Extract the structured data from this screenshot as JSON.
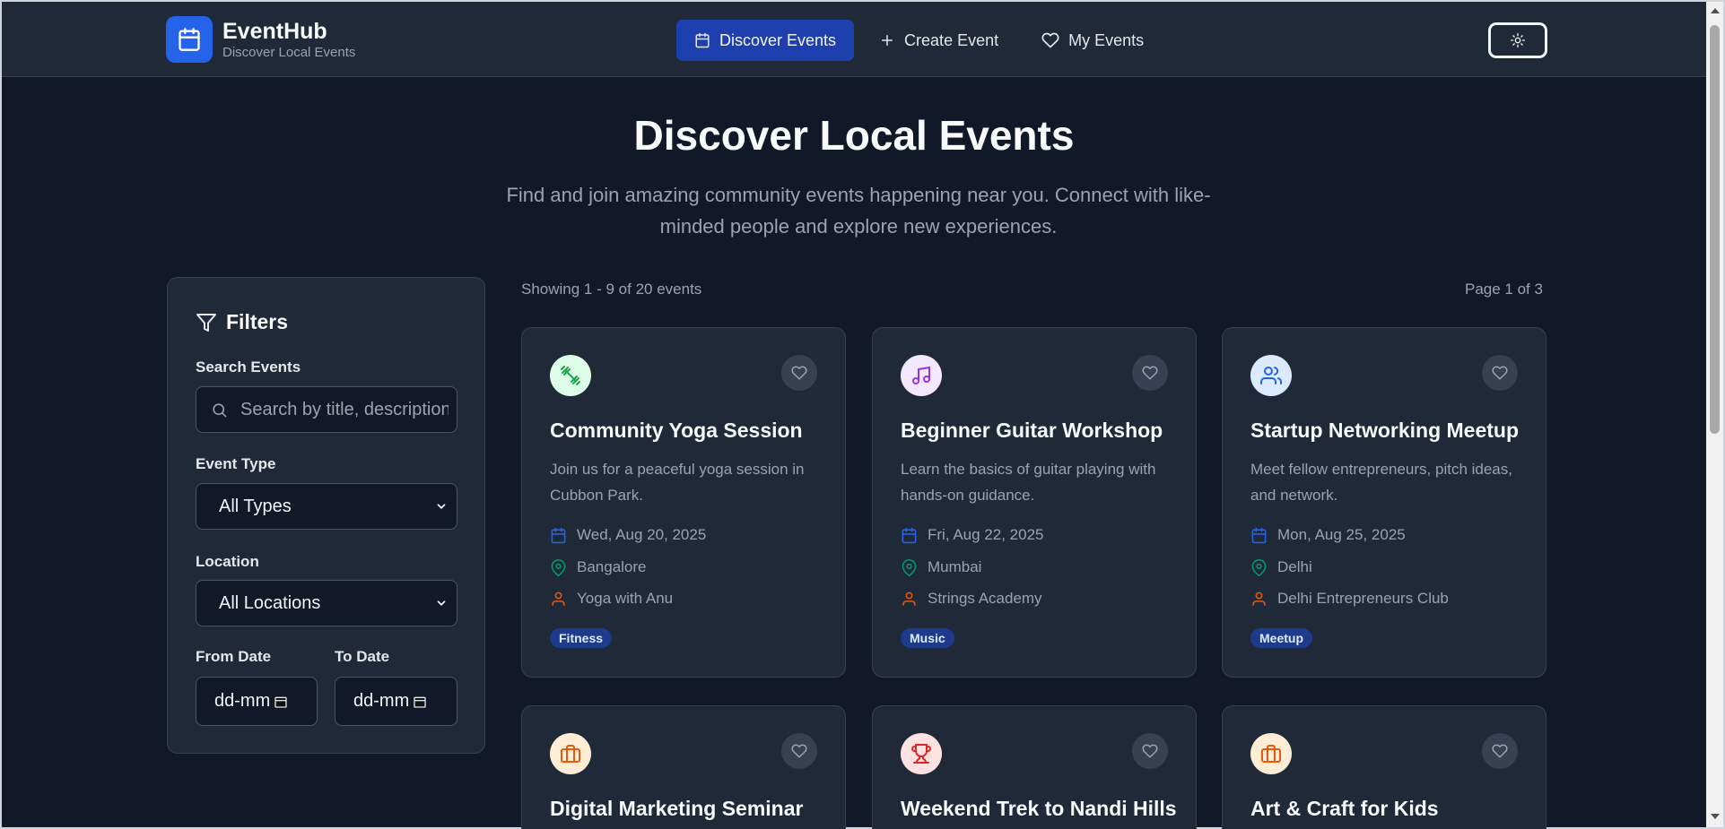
{
  "header": {
    "brand_name": "EventHub",
    "brand_sub": "Discover Local Events",
    "nav": [
      {
        "label": "Discover Events",
        "icon": "calendar-icon",
        "active": true
      },
      {
        "label": "Create Event",
        "icon": "plus-icon",
        "active": false
      },
      {
        "label": "My Events",
        "icon": "heart-icon",
        "active": false
      }
    ],
    "theme_toggle_icon": "sun-icon"
  },
  "hero": {
    "title": "Discover Local Events",
    "subtitle_line1": "Find and join amazing community events happening near you. Connect with like-",
    "subtitle_line2": "minded people and explore new experiences."
  },
  "filters": {
    "title": "Filters",
    "search_label": "Search Events",
    "search_placeholder": "Search by title, description...",
    "type_label": "Event Type",
    "type_value": "All Types",
    "location_label": "Location",
    "location_value": "All Locations",
    "from_label": "From Date",
    "to_label": "To Date",
    "from_value": "dd-mm",
    "to_value": "dd-mm"
  },
  "results": {
    "showing": "Showing 1 - 9 of 20 events",
    "page": "Page 1 of 3"
  },
  "cards": [
    {
      "title": "Community Yoga Session",
      "desc": "Join us for a peaceful yoga session in Cubbon Park.",
      "date": "Wed, Aug 20, 2025",
      "location": "Bangalore",
      "organizer": "Yoga with Anu",
      "tag": "Fitness",
      "icon": "dumbbell-icon",
      "icon_bg": "#dcfce7",
      "icon_color": "#16a34a"
    },
    {
      "title": "Beginner Guitar Workshop",
      "desc": "Learn the basics of guitar playing with hands-on guidance.",
      "date": "Fri, Aug 22, 2025",
      "location": "Mumbai",
      "organizer": "Strings Academy",
      "tag": "Music",
      "icon": "music-note-icon",
      "icon_bg": "#f3e8ff",
      "icon_color": "#9333ea"
    },
    {
      "title": "Startup Networking Meetup",
      "desc": "Meet fellow entrepreneurs, pitch ideas, and network.",
      "date": "Mon, Aug 25, 2025",
      "location": "Delhi",
      "organizer": "Delhi Entrepreneurs Club",
      "tag": "Meetup",
      "icon": "users-icon",
      "icon_bg": "#dbeafe",
      "icon_color": "#2563eb"
    },
    {
      "title": "Digital Marketing Seminar",
      "icon": "briefcase-icon",
      "icon_bg": "#ffedd5",
      "icon_color": "#ea580c"
    },
    {
      "title": "Weekend Trek to Nandi Hills",
      "icon": "trophy-icon",
      "icon_bg": "#fee2e2",
      "icon_color": "#dc2626"
    },
    {
      "title": "Art & Craft for Kids",
      "icon": "briefcase-icon",
      "icon_bg": "#ffedd5",
      "icon_color": "#ea580c"
    }
  ]
}
